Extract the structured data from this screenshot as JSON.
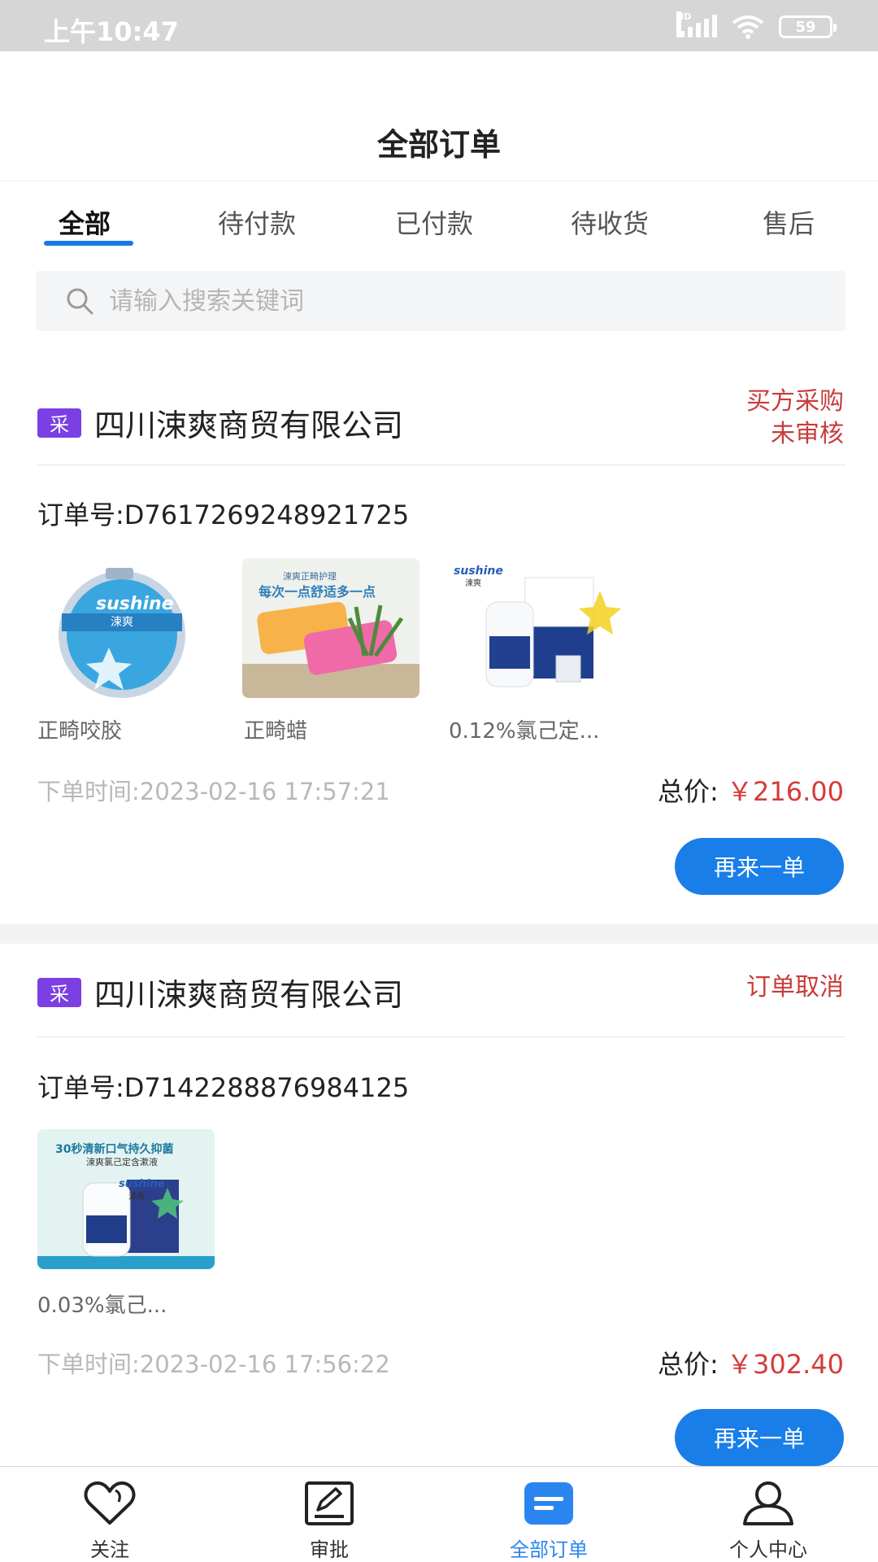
{
  "status_bar": {
    "time": "上午10:47",
    "battery": "59"
  },
  "header": {
    "title": "全部订单"
  },
  "tabs": [
    {
      "label": "全部",
      "active": true
    },
    {
      "label": "待付款",
      "active": false
    },
    {
      "label": "已付款",
      "active": false
    },
    {
      "label": "待收货",
      "active": false
    },
    {
      "label": "售后",
      "active": false
    }
  ],
  "search": {
    "placeholder": "请输入搜索关键词"
  },
  "orders": [
    {
      "tag": "采",
      "shop": "四川涑爽商贸有限公司",
      "status_line1": "买方采购",
      "status_line2": "未审核",
      "order_no": "订单号:D7617269248921725",
      "products": [
        {
          "name": "正畸咬胶",
          "brand": "sushine",
          "brand_cn": "涑爽"
        },
        {
          "name": "正畸蜡",
          "banner": "每次一点舒适多一点",
          "top": "涑爽正畸护理"
        },
        {
          "name": "0.12%氯己定...",
          "brand": "sushine",
          "brand_cn": "涑爽"
        }
      ],
      "time": "下单时间:2023-02-16 17:57:21",
      "total_label": "总价:",
      "total": "￥216.00",
      "button": "再来一单"
    },
    {
      "tag": "采",
      "shop": "四川涑爽商贸有限公司",
      "status_line1": "订单取消",
      "order_no": "订单号:D7142288876984125",
      "products": [
        {
          "name": "0.03%氯己...",
          "banner": "30秒清新口气持久抑菌",
          "sub": "涑爽氯己定含漱液",
          "brand": "sushine",
          "brand_cn": "涑爽"
        }
      ],
      "time": "下单时间:2023-02-16 17:56:22",
      "total_label": "总价:",
      "total": "￥302.40",
      "button": "再来一单"
    }
  ],
  "tabbar": [
    {
      "label": "关注",
      "icon": "heart-icon",
      "active": false
    },
    {
      "label": "审批",
      "icon": "edit-icon",
      "active": false
    },
    {
      "label": "全部订单",
      "icon": "orders-icon",
      "active": true
    },
    {
      "label": "个人中心",
      "icon": "user-icon",
      "active": false
    }
  ],
  "colors": {
    "accent": "#1677e6",
    "tag": "#7b3fe4",
    "price": "#d63a3a",
    "status": "#c83c3c"
  }
}
